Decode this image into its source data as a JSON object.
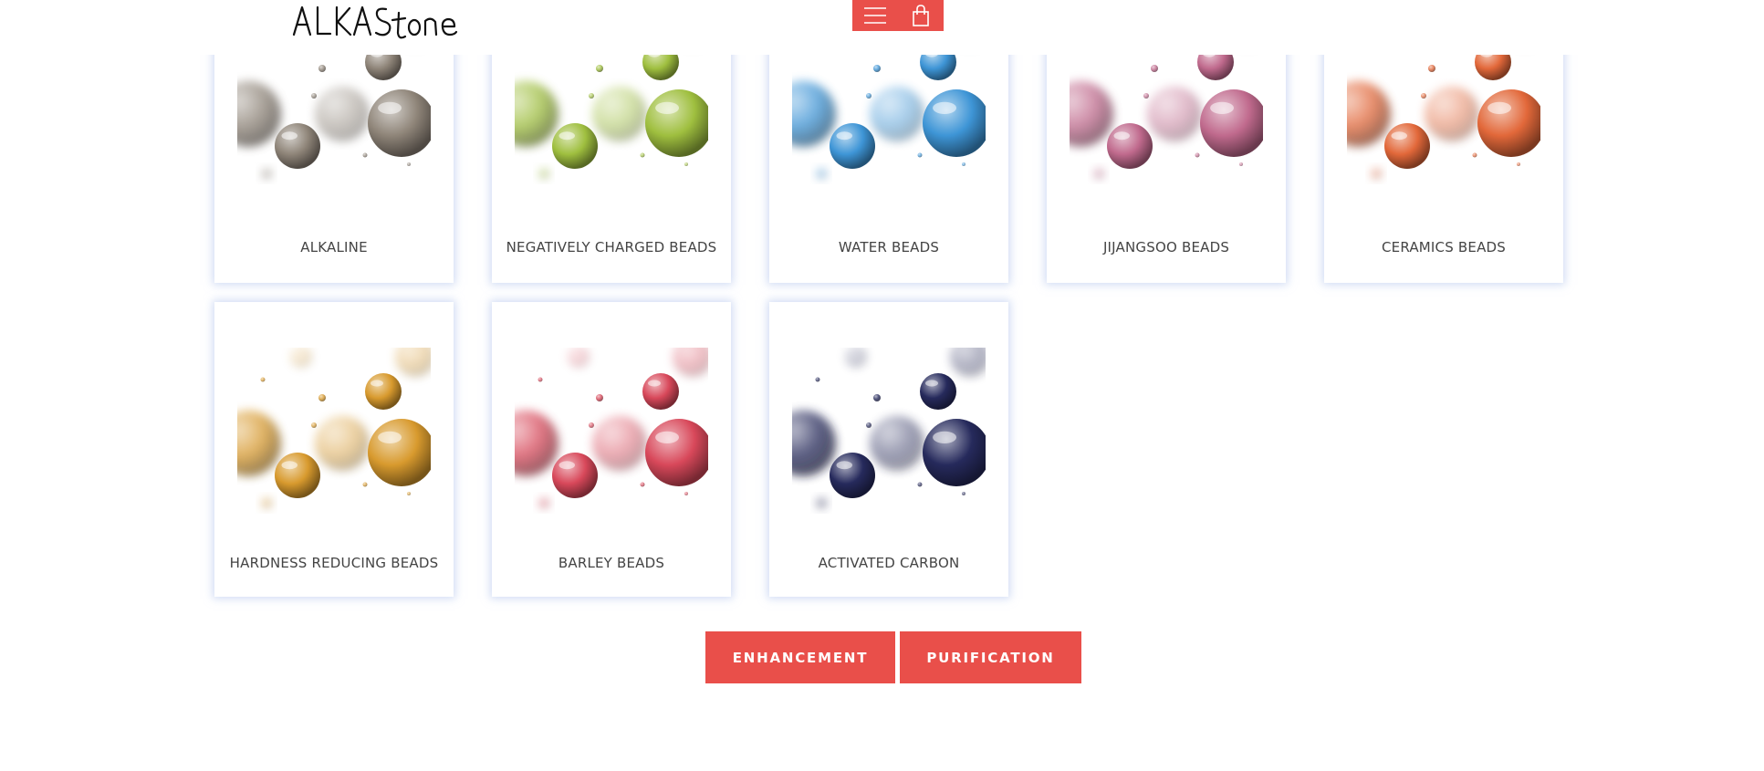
{
  "brand": {
    "logo_text": "ALKAStone"
  },
  "header": {
    "menu_icon": "hamburger-menu-icon",
    "cart_icon": "shopping-bag-icon",
    "accent": "#e94f4a"
  },
  "products": [
    {
      "label": "ALKALINE",
      "color": "#8f8579"
    },
    {
      "label": "NEGATIVELY CHARGED BEADS",
      "color": "#9fbf3f"
    },
    {
      "label": "WATER BEADS",
      "color": "#3e95d6"
    },
    {
      "label": "JIJANGSOO BEADS",
      "color": "#c06a8d"
    },
    {
      "label": "CERAMICS BEADS",
      "color": "#e2683a"
    },
    {
      "label": "HARDNESS REDUCING BEADS",
      "color": "#d89a2e"
    },
    {
      "label": "BARLEY BEADS",
      "color": "#d8485a"
    },
    {
      "label": "ACTIVATED CARBON",
      "color": "#262a5c"
    }
  ],
  "buttons": {
    "enhancement": "ENHANCEMENT",
    "purification": "PURIFICATION"
  }
}
